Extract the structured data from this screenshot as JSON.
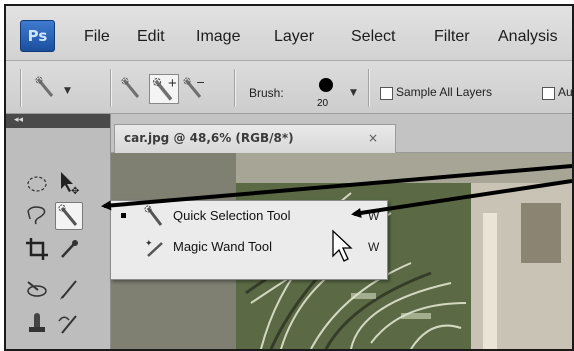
{
  "menubar": {
    "logo": "Ps",
    "items": [
      "File",
      "Edit",
      "Image",
      "Layer",
      "Select",
      "Filter",
      "Analysis"
    ]
  },
  "options_bar": {
    "brush_label": "Brush:",
    "brush_size": "20",
    "sample_all_layers": "Sample All Layers",
    "auto_enhance_partial": "Au"
  },
  "document": {
    "tab_title": "car.jpg @ 48,6% (RGB/8*)",
    "close_glyph": "×"
  },
  "flyout": {
    "items": [
      {
        "label": "Quick Selection Tool",
        "shortcut": "W",
        "selected": true,
        "icon": "quick-selection-icon"
      },
      {
        "label": "Magic Wand Tool",
        "shortcut": "W",
        "selected": false,
        "icon": "magic-wand-icon"
      }
    ]
  },
  "panel": {
    "collapse_glyph": "◂◂"
  },
  "colors": {
    "accent_logo": "#2a63b8",
    "annotation_arrow": "#000000"
  }
}
